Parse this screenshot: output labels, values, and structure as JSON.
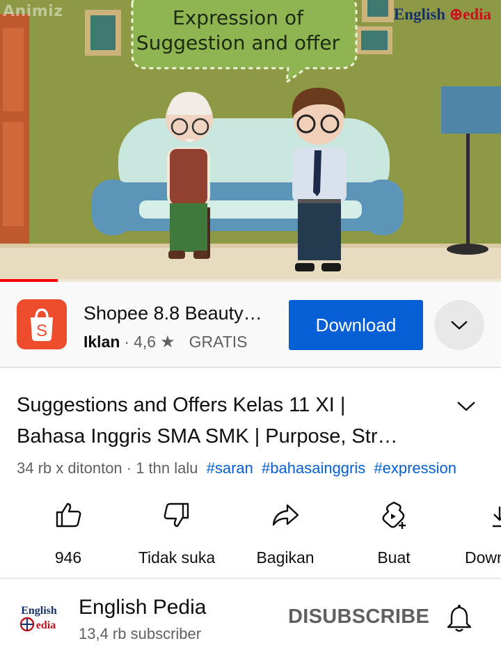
{
  "player": {
    "watermark_left": "Animiz",
    "watermark_right_a": "English ",
    "watermark_right_b": "edia",
    "bubble_line1": "Expression of",
    "bubble_line2": "Suggestion and offer",
    "progress_fraction": 0.115
  },
  "ad": {
    "title": "Shopee 8.8 Beauty…",
    "label": "Iklan",
    "separator": "·",
    "rating": "4,6",
    "price": "GRATIS",
    "cta": "Download",
    "brand_color": "#ee4d2d"
  },
  "video": {
    "title_line1": "Suggestions and Offers Kelas 11 XI |",
    "title_line2": "Bahasa Inggris SMA SMK | Purpose, Str…",
    "views_age": "34 rb x ditonton · 1 thn lalu",
    "hashtags": [
      "#saran",
      "#bahasainggris",
      "#expression"
    ]
  },
  "actions": {
    "like": "946",
    "dislike": "Tidak suka",
    "share": "Bagikan",
    "create": "Buat",
    "download": "Down"
  },
  "channel": {
    "logo_line1": "English",
    "logo_line2": "edia",
    "name": "English Pedia",
    "subscribers": "13,4 rb subscriber",
    "subscribe_button": "DISUBSCRIBE"
  },
  "colors": {
    "accent_blue": "#065fd4",
    "progress_red": "#ff0000"
  }
}
